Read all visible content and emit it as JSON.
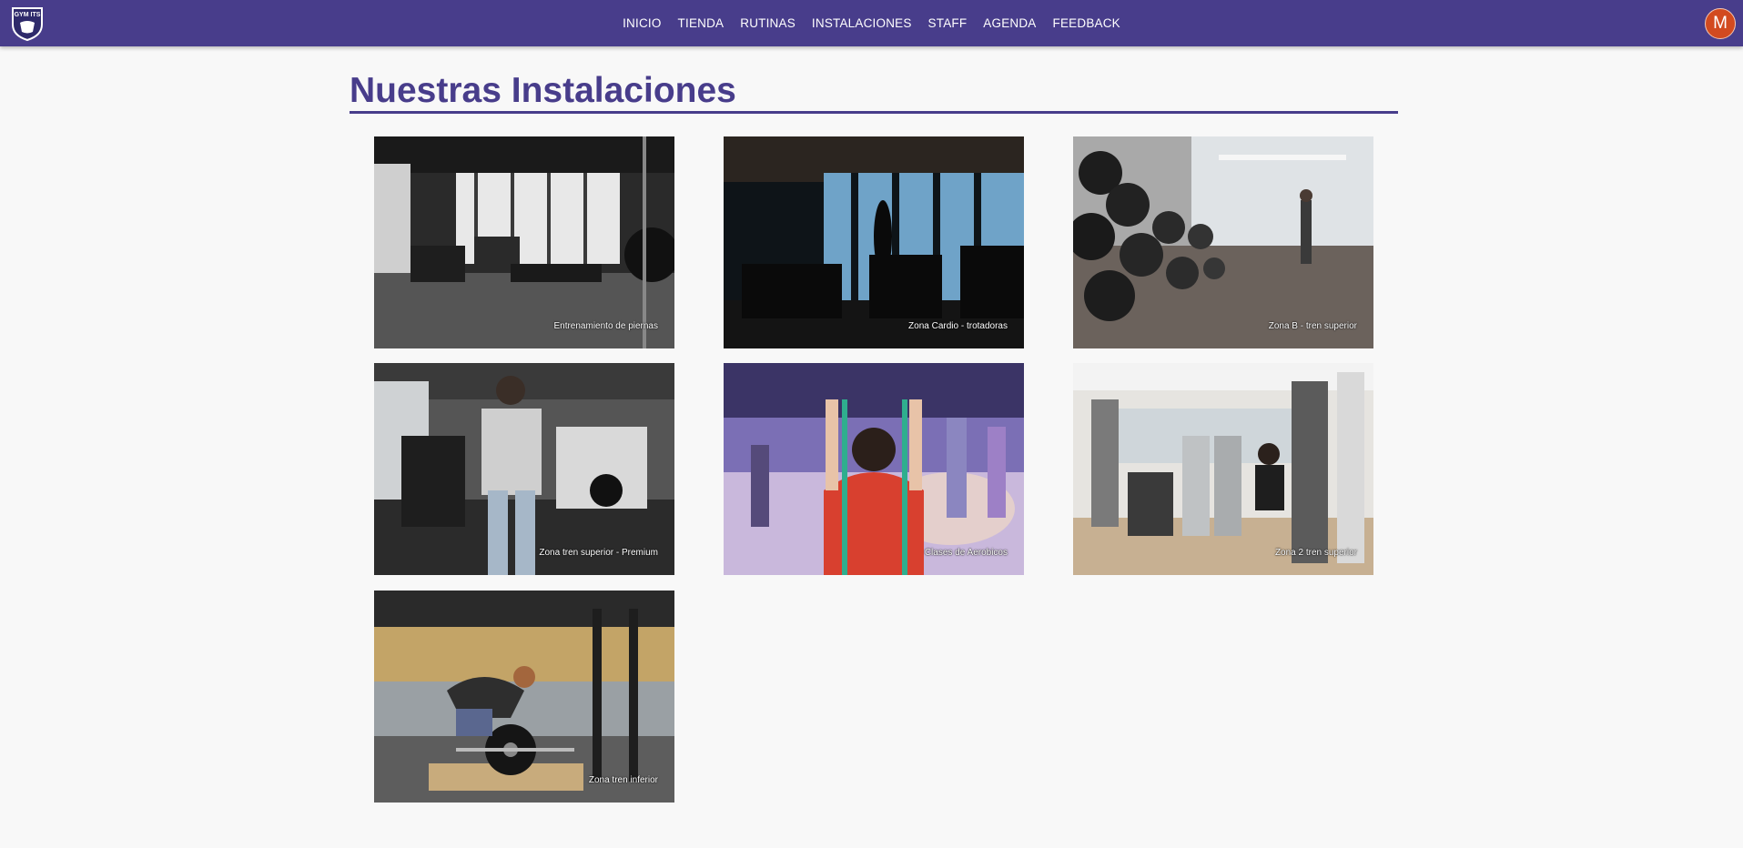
{
  "navbar": {
    "logo_text": "GYM ITS",
    "links": [
      "INICIO",
      "TIENDA",
      "RUTINAS",
      "INSTALACIONES",
      "STAFF",
      "AGENDA",
      "FEEDBACK"
    ],
    "avatar_letter": "M"
  },
  "page": {
    "title": "Nuestras Instalaciones"
  },
  "facilities": [
    {
      "caption": "Entrenamiento de piernas"
    },
    {
      "caption": "Zona Cardio - trotadoras"
    },
    {
      "caption": "Zona B - tren superior"
    },
    {
      "caption": "Zona tren superior - Premium"
    },
    {
      "caption": "Clases de Aerobicos"
    },
    {
      "caption": "Zona 2 tren superior"
    },
    {
      "caption": "Zona tren inferior"
    }
  ],
  "colors": {
    "brand": "#483d8b",
    "avatar": "#d24a1f",
    "background": "#f8f8f8"
  }
}
